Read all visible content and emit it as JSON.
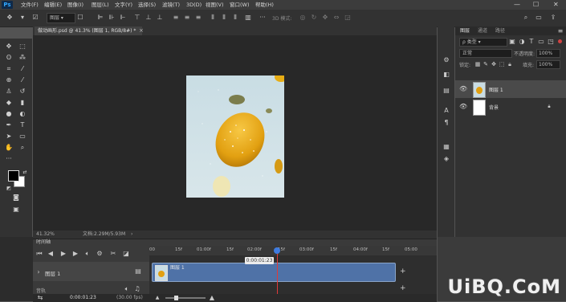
{
  "menu": {
    "logo": "Ps",
    "items": [
      "文件(F)",
      "编辑(E)",
      "图像(I)",
      "图层(L)",
      "文字(Y)",
      "选择(S)",
      "滤镜(T)",
      "3D(D)",
      "视图(V)",
      "窗口(W)",
      "帮助(H)"
    ]
  },
  "window_controls": {
    "minimize": "—",
    "maximize": "☐",
    "close": "✕"
  },
  "options": {
    "layer_dropdown": "图层",
    "mode_3d": "3D 模式:"
  },
  "document": {
    "tab_title": "做动画形.psd @ 41.3% (图层 1, RGB/8#) *",
    "tab_close": "×"
  },
  "status": {
    "zoom": "41.32%",
    "doc_info": "文档:2.29M/5.93M",
    "arrow": "›"
  },
  "panel": {
    "tabs": [
      "图层",
      "通道",
      "路径"
    ],
    "kind_filter": "ρ 类型",
    "blend_mode": "正常",
    "opacity_label": "不透明度:",
    "opacity_value": "100%",
    "lock_label": "锁定:",
    "fill_label": "填充:",
    "fill_value": "100%",
    "layers": [
      {
        "name": "图层 1",
        "selected": true
      },
      {
        "name": "背景",
        "selected": false,
        "locked": true
      }
    ]
  },
  "timeline": {
    "title": "时间轴",
    "layer_name": "图层 1",
    "audio_label": "音轨",
    "ruler_ticks": [
      "00",
      "15f",
      "01:00f",
      "15f",
      "02:00f",
      "15f",
      "03:00f",
      "15f",
      "04:00f",
      "15f",
      "05:00"
    ],
    "current_time_flag": "0:00:01:23",
    "current_time": "0:00:01:23",
    "fps": "(30.00 fps)"
  },
  "watermark": "UiBQ.CoM"
}
